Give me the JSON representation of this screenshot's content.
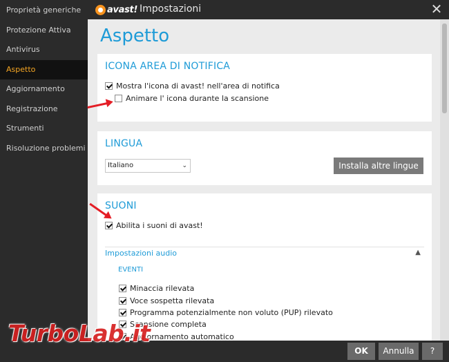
{
  "window": {
    "title": "Impostazioni",
    "brand": "avast!"
  },
  "sidebar": {
    "items": [
      {
        "label": "Proprietà generiche"
      },
      {
        "label": "Protezione Attiva"
      },
      {
        "label": "Antivirus"
      },
      {
        "label": "Aspetto",
        "active": true
      },
      {
        "label": "Aggiornamento"
      },
      {
        "label": "Registrazione"
      },
      {
        "label": "Strumenti"
      },
      {
        "label": "Risoluzione problemi"
      }
    ]
  },
  "main": {
    "page_title": "Aspetto",
    "notification_area": {
      "title": "ICONA AREA DI NOTIFICA",
      "show_icon": {
        "label": "Mostra l'icona di avast! nell'area di notifica",
        "checked": true
      },
      "animate_icon": {
        "label": "Animare l' icona durante la scansione",
        "checked": false
      }
    },
    "language": {
      "title": "LINGUA",
      "selected": "Italiano",
      "install_button": "Installa altre lingue"
    },
    "sounds": {
      "title": "SUONI",
      "enable_sounds": {
        "label": "Abilita i suoni di avast!",
        "checked": true
      },
      "audio_settings": "Impostazioni audio",
      "events_label": "EVENTI",
      "events": [
        {
          "label": "Minaccia rilevata",
          "checked": true
        },
        {
          "label": "Voce sospetta rilevata",
          "checked": true
        },
        {
          "label": "Programma potenzialmente non voluto (PUP) rilevato",
          "checked": true
        },
        {
          "label": "Scansione completa",
          "checked": true
        },
        {
          "label": "Aggiornamento automatico",
          "checked": true
        }
      ]
    }
  },
  "footer": {
    "ok": "OK",
    "cancel": "Annulla",
    "help": "?"
  },
  "watermark": "TurboLab.it",
  "colors": {
    "accent": "#1e9bd7",
    "active_menu": "#f5a623",
    "arrow": "#e41e26"
  }
}
